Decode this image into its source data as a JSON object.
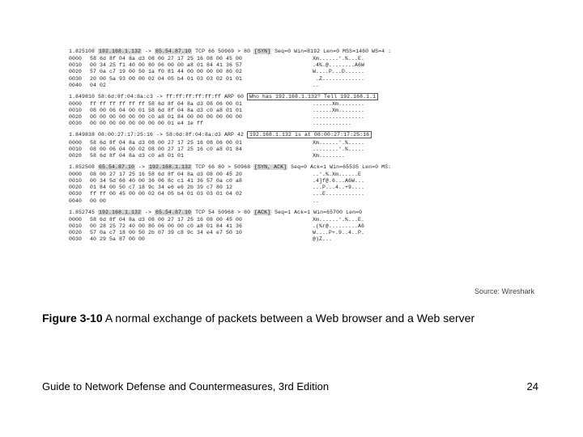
{
  "source": "Source: Wireshark",
  "figure_label": "Figure 3-10",
  "figure_caption": "A normal exchange of packets between a Web browser and a Web server",
  "footer_book": "Guide to Network Defense and Countermeasures, 3rd Edition",
  "footer_page": "24",
  "packets": [
    {
      "s_pre": "1.825108 ",
      "s_src": "192.168.1.132",
      "s_mid1": " -> ",
      "s_dst": "65.54.87.10",
      "s_mid2": " TCP 66 50969 > 80 ",
      "s_flag": "[SYN]",
      "s_post": " Seq=0 Win=8192 Len=0 MSS=1460 WS=4 :",
      "hex": [
        {
          "o": "0000",
          "h": "58 6d 8f 04 8a d3 08 00 27 17 25 16 08 00 45 00",
          "a": "Xm......'.%...E."
        },
        {
          "o": "0010",
          "h": "00 34 25 f1 40 00 80 06 00 00 a8 01 84 41 36 57",
          "a": ".4%.@........A6W"
        },
        {
          "o": "0020",
          "h": "57 0a c7 19 00 50 1a f0 81 44 00 00 00 00 80 02",
          "a": "W....P...D......"
        },
        {
          "o": "0030",
          "h": "20 00 5a 93 00 00 02 04 05 b4 01 03 03 02 01 01",
          "a": " .Z............."
        },
        {
          "o": "0040",
          "h": "04 02",
          "a": ".."
        }
      ]
    },
    {
      "s_pre": "1.849810 58:6d:8f:04:8a:c3 -> ff:ff:ff:ff:ff:ff ARP 60 ",
      "s_box": "Who has 192.168.1.132?  Tell 192.168.1.1",
      "hex": [
        {
          "o": "0000",
          "h": "ff ff ff ff ff ff 58 6d 8f 04 8a d3 08 06 00 01",
          "a": "......Xm........"
        },
        {
          "o": "0010",
          "h": "08 00 06 04 00 01 58 6d 8f 04 8a d3 c0 a8 01 01",
          "a": "......Xm........"
        },
        {
          "o": "0020",
          "h": "00 00 00 00 00 00 c0 a8 01 84 00 00 00 00 00 00",
          "a": "................"
        },
        {
          "o": "0030",
          "h": "00 00 00 00 00 00 00 00 01 e4 1e ff",
          "a": "............"
        }
      ]
    },
    {
      "s_pre": "1.849838 08:00:27:17:25:16 -> 58:6d:8f:04:8a:d3 ARP 42 ",
      "s_box": "192.168.1.132 is at 08:00:27:17:25:16",
      "hex": [
        {
          "o": "0000",
          "h": "58 6d 8f 04 8a d3 08 00 27 17 25 16 08 06 00 01",
          "a": "Xm......'.%....."
        },
        {
          "o": "0010",
          "h": "08 00 06 04 00 02 08 00 27 17 25 16 c0 a8 01 84",
          "a": "........'.%....."
        },
        {
          "o": "0020",
          "h": "58 6d 8f 04 8a d3 c0 a8 01 01",
          "a": "Xm........"
        }
      ]
    },
    {
      "s_pre": "1.852508 ",
      "s_src": "65.54.87.10",
      "s_mid1": " -> ",
      "s_dst": "192.168.1.132",
      "s_mid2": " TCP 66 80 > 50968 ",
      "s_flag": "[SYN, ACK]",
      "s_post": " Seq=0 Ack=1 Win=65535 Len=0 MS:",
      "hex": [
        {
          "o": "0000",
          "h": "08 00 27 17 25 16 58 6d 8f 04 8a d3 08 00 45 20",
          "a": "..'.%.Xm......E "
        },
        {
          "o": "0010",
          "h": "00 34 5d 66 40 00 36 06 8c c1 41 36 57 0a c0 a8",
          "a": ".4]f@.6...A6W..."
        },
        {
          "o": "0020",
          "h": "01 84 00 50 c7 18 9c 34 e6 e6 2b 39 c7 80 12   ",
          "a": "...P...4..+9...."
        },
        {
          "o": "0030",
          "h": "ff ff 00 45 00 00 02 04 05 b4 01 03 03 01 04 02",
          "a": "...E............"
        },
        {
          "o": "0040",
          "h": "00 00",
          "a": ".."
        }
      ]
    },
    {
      "s_pre": "1.852745 ",
      "s_src": "192.168.1.132",
      "s_mid1": " -> ",
      "s_dst": "65.54.87.10",
      "s_mid2": " TCP 54 50968 > 80 ",
      "s_flag": "[ACK]",
      "s_post": " Seq=1 Ack=1 Win=65700 Len=0",
      "hex": [
        {
          "o": "0000",
          "h": "58 6d 8f 04 8a d3 08 00 27 17 25 16 08 00 45 00",
          "a": "Xm......'.%...E."
        },
        {
          "o": "0010",
          "h": "00 28 25 72 40 00 80 06 00 00 c0 a8 01 84 41 36",
          "a": ".(%r@.........A6"
        },
        {
          "o": "0020",
          "h": "57 0a c7 18 00 50 2b 07 39 c8 9c 34 e4 e7 50 10",
          "a": "W....P+.9..4..P."
        },
        {
          "o": "0030",
          "h": "40 29 5a 87 00 00",
          "a": "@)Z..."
        }
      ]
    }
  ]
}
